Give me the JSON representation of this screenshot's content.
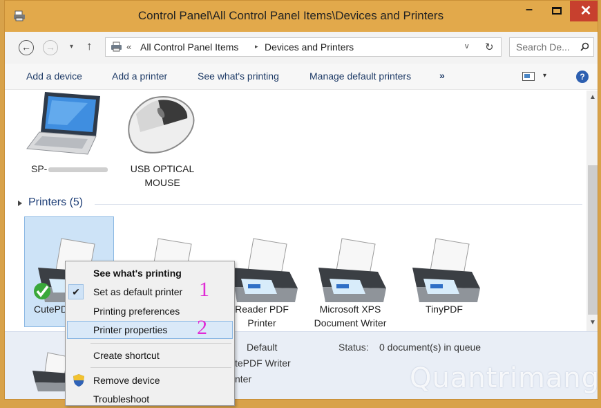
{
  "window": {
    "title": "Control Panel\\All Control Panel Items\\Devices and Printers"
  },
  "titlebar": {
    "minimize": "–",
    "close": "✕"
  },
  "nav": {
    "back": "←",
    "forward": "→",
    "recent": "▾",
    "up": "↑"
  },
  "address": {
    "chevron": "«",
    "crumbs": [
      "All Control Panel Items",
      "Devices and Printers"
    ],
    "separator": "▸",
    "dropdown": "v",
    "refresh": "↻"
  },
  "search": {
    "placeholder": "Search De..."
  },
  "commands": {
    "items": [
      "Add a device",
      "Add a printer",
      "See what's printing",
      "Manage default printers"
    ],
    "more": "»",
    "view_dropdown": "▾",
    "help": "?"
  },
  "devices": [
    {
      "name": "SP-",
      "name_redacted": true,
      "icon": "laptop-icon"
    },
    {
      "name": "USB OPTICAL MOUSE",
      "line1": "USB OPTICAL",
      "line2": "MOUSE",
      "icon": "mouse-icon"
    }
  ],
  "printers_group": {
    "label": "Printers (5)"
  },
  "printers": [
    {
      "label": "CutePD",
      "icon": "printer-icon",
      "default": true
    },
    {
      "label": "",
      "icon": "printer-icon"
    },
    {
      "line1": "Reader PDF",
      "line2": "Printer",
      "icon": "printer-icon"
    },
    {
      "line1": "Microsoft XPS",
      "line2": "Document Writer",
      "icon": "printer-icon"
    },
    {
      "line1": "TinyPDF",
      "icon": "printer-icon"
    }
  ],
  "details": {
    "default_text": "Default",
    "name_text": "tePDF Writer",
    "inter_text": "nter",
    "status_label": "Status:",
    "status_value": "0 document(s) in queue",
    "watermark": "Quantrimang"
  },
  "context_menu": {
    "items": [
      {
        "label": "See what's printing",
        "bold": true
      },
      {
        "label": "Set as default printer",
        "checked": true,
        "annotation": "1"
      },
      {
        "label": "Printing preferences"
      },
      {
        "label": "Printer properties",
        "highlighted": true,
        "annotation": "2"
      },
      {
        "label": "Create shortcut"
      },
      {
        "label": "Remove device",
        "icon": "shield-icon"
      },
      {
        "label": "Troubleshoot"
      }
    ],
    "check_mark": "✔"
  },
  "scrollbar": {
    "up": "▲",
    "down": "▼"
  },
  "colors": {
    "titlebar": "#e2a94b",
    "close": "#c7402e",
    "selection": "#cde3f7",
    "annotation": "#e02ad5",
    "link": "#1d3a66"
  }
}
